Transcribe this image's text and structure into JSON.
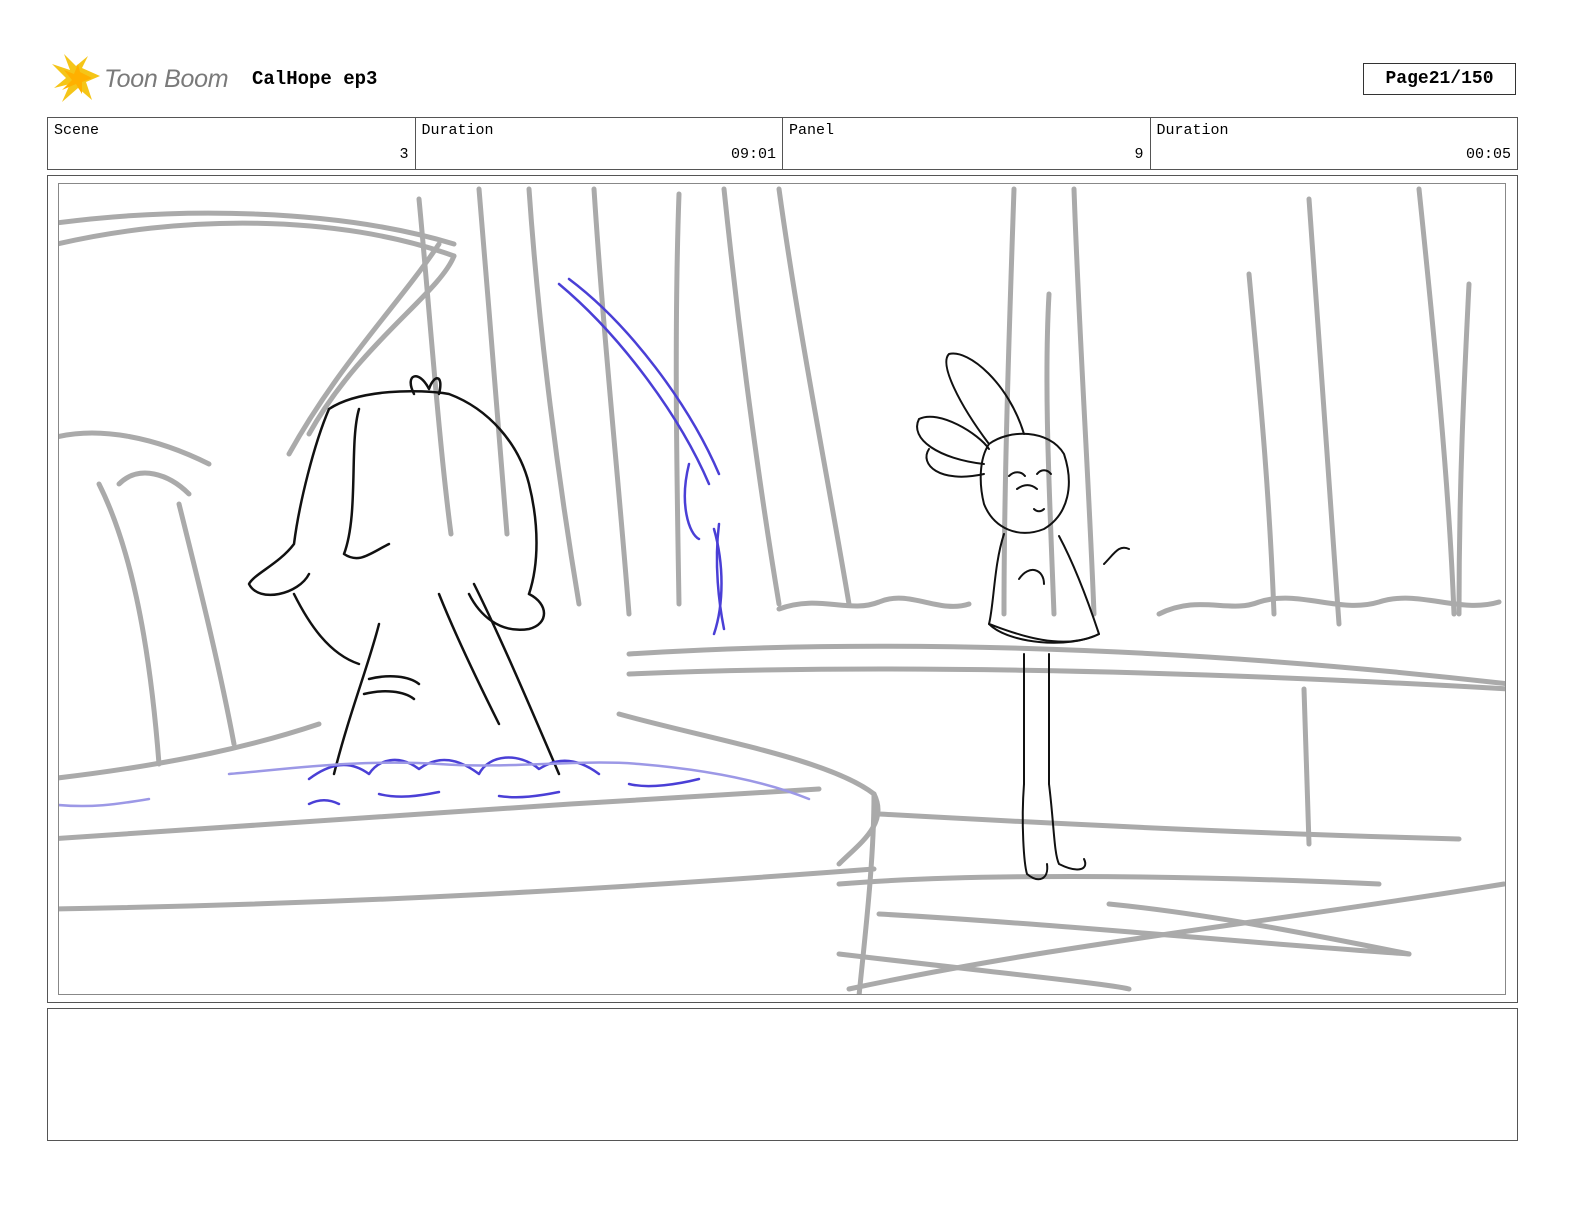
{
  "header": {
    "logo_text": "Toon Boom",
    "project_title": "CalHope ep3",
    "page_label": "Page",
    "page_number": "21/150"
  },
  "info": {
    "scene_label": "Scene",
    "scene_value": "3",
    "scene_duration_label": "Duration",
    "scene_duration_value": "09:01",
    "panel_label": "Panel",
    "panel_value": "9",
    "panel_duration_label": "Duration",
    "panel_duration_value": "00:05"
  },
  "colors": {
    "logo_yellow": "#f5c518",
    "background_sketch": "#aaaaaa",
    "character_line": "#111111",
    "water_line": "#4a3fd6"
  },
  "icons": {
    "logo_mark": "toon-boom-starburst-icon"
  }
}
